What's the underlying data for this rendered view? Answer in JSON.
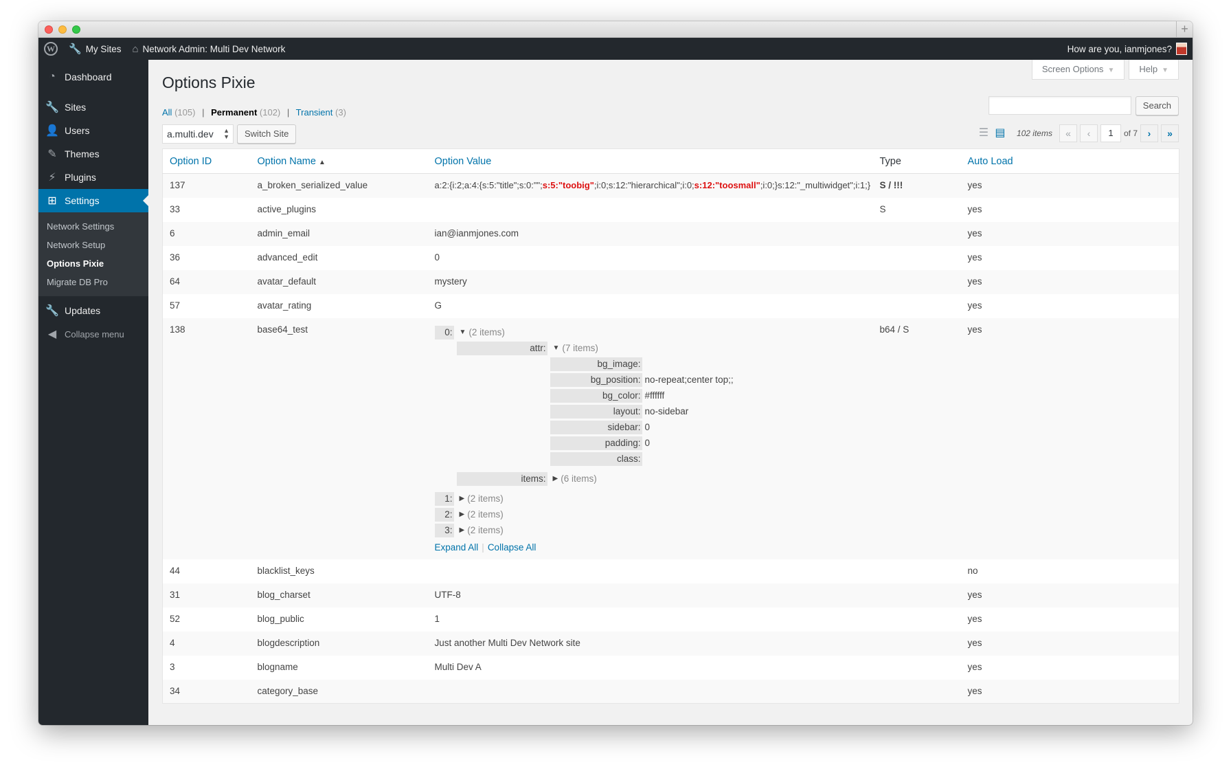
{
  "adminbar": {
    "my_sites": "My Sites",
    "network_admin": "Network Admin: Multi Dev Network",
    "greeting": "How are you, ianmjones?"
  },
  "sidebar": {
    "items": [
      {
        "label": "Dashboard",
        "icon": "dashboard-icon"
      },
      {
        "label": "Sites",
        "icon": "sites-icon"
      },
      {
        "label": "Users",
        "icon": "users-icon"
      },
      {
        "label": "Themes",
        "icon": "themes-icon"
      },
      {
        "label": "Plugins",
        "icon": "plugins-icon"
      },
      {
        "label": "Settings",
        "icon": "settings-icon"
      },
      {
        "label": "Updates",
        "icon": "updates-icon"
      },
      {
        "label": "Collapse menu",
        "icon": "collapse-icon"
      }
    ],
    "submenu": [
      "Network Settings",
      "Network Setup",
      "Options Pixie",
      "Migrate DB Pro"
    ]
  },
  "screen_meta": {
    "screen_options": "Screen Options",
    "help": "Help"
  },
  "page": {
    "title": "Options Pixie",
    "filters": {
      "all": "All",
      "all_count": "(105)",
      "permanent": "Permanent",
      "permanent_count": "(102)",
      "transient": "Transient",
      "transient_count": "(3)"
    },
    "search_button": "Search",
    "site_select": "a.multi.dev",
    "switch_site": "Switch Site",
    "items_count": "102 items",
    "current_page": "1",
    "of_pages": "of 7"
  },
  "table": {
    "columns": [
      "Option ID",
      "Option Name",
      "Option Value",
      "Type",
      "Auto Load"
    ],
    "rows": [
      {
        "id": "137",
        "name": "a_broken_serialized_value",
        "value": "",
        "type": "S / !!!",
        "autoload": "yes"
      },
      {
        "id": "33",
        "name": "active_plugins",
        "value": "",
        "type": "S",
        "autoload": "yes"
      },
      {
        "id": "6",
        "name": "admin_email",
        "value": "ian@ianmjones.com",
        "type": "",
        "autoload": "yes"
      },
      {
        "id": "36",
        "name": "advanced_edit",
        "value": "0",
        "type": "",
        "autoload": "yes"
      },
      {
        "id": "64",
        "name": "avatar_default",
        "value": "mystery",
        "type": "",
        "autoload": "yes"
      },
      {
        "id": "57",
        "name": "avatar_rating",
        "value": "G",
        "type": "",
        "autoload": "yes"
      },
      {
        "id": "138",
        "name": "base64_test",
        "value": "",
        "type": "b64 / S",
        "autoload": "yes"
      },
      {
        "id": "44",
        "name": "blacklist_keys",
        "value": "",
        "type": "",
        "autoload": "no"
      },
      {
        "id": "31",
        "name": "blog_charset",
        "value": "UTF-8",
        "type": "",
        "autoload": "yes"
      },
      {
        "id": "52",
        "name": "blog_public",
        "value": "1",
        "type": "",
        "autoload": "yes"
      },
      {
        "id": "4",
        "name": "blogdescription",
        "value": "Just another Multi Dev Network site",
        "type": "",
        "autoload": "yes"
      },
      {
        "id": "3",
        "name": "blogname",
        "value": "Multi Dev A",
        "type": "",
        "autoload": "yes"
      },
      {
        "id": "34",
        "name": "category_base",
        "value": "",
        "type": "",
        "autoload": "yes"
      }
    ],
    "broken_value": {
      "p1": "a:2:{i:2;a:4:{s:5:\"title\";s:0:\"\";",
      "r1": "s:5:\"toobig\"",
      "p2": ";i:0;s:12:\"hierarchical\";i:0;",
      "r2": "s:12:\"toosmall\"",
      "p3": ";i:0;}s:12:\"_multiwidget\";i:1;}"
    },
    "tree": {
      "k0": "0:",
      "k0_count": "(2 items)",
      "attr": "attr:",
      "attr_count": "(7 items)",
      "attrs": [
        {
          "k": "bg_image:",
          "v": ""
        },
        {
          "k": "bg_position:",
          "v": "no-repeat;center top;;"
        },
        {
          "k": "bg_color:",
          "v": "#ffffff"
        },
        {
          "k": "layout:",
          "v": "no-sidebar"
        },
        {
          "k": "sidebar:",
          "v": "0"
        },
        {
          "k": "padding:",
          "v": "0"
        },
        {
          "k": "class:",
          "v": ""
        }
      ],
      "items": "items:",
      "items_count": "(6 items)",
      "others": [
        {
          "k": "1:",
          "count": "(2 items)"
        },
        {
          "k": "2:",
          "count": "(2 items)"
        },
        {
          "k": "3:",
          "count": "(2 items)"
        }
      ],
      "expand_all": "Expand All",
      "collapse_all": "Collapse All"
    }
  }
}
